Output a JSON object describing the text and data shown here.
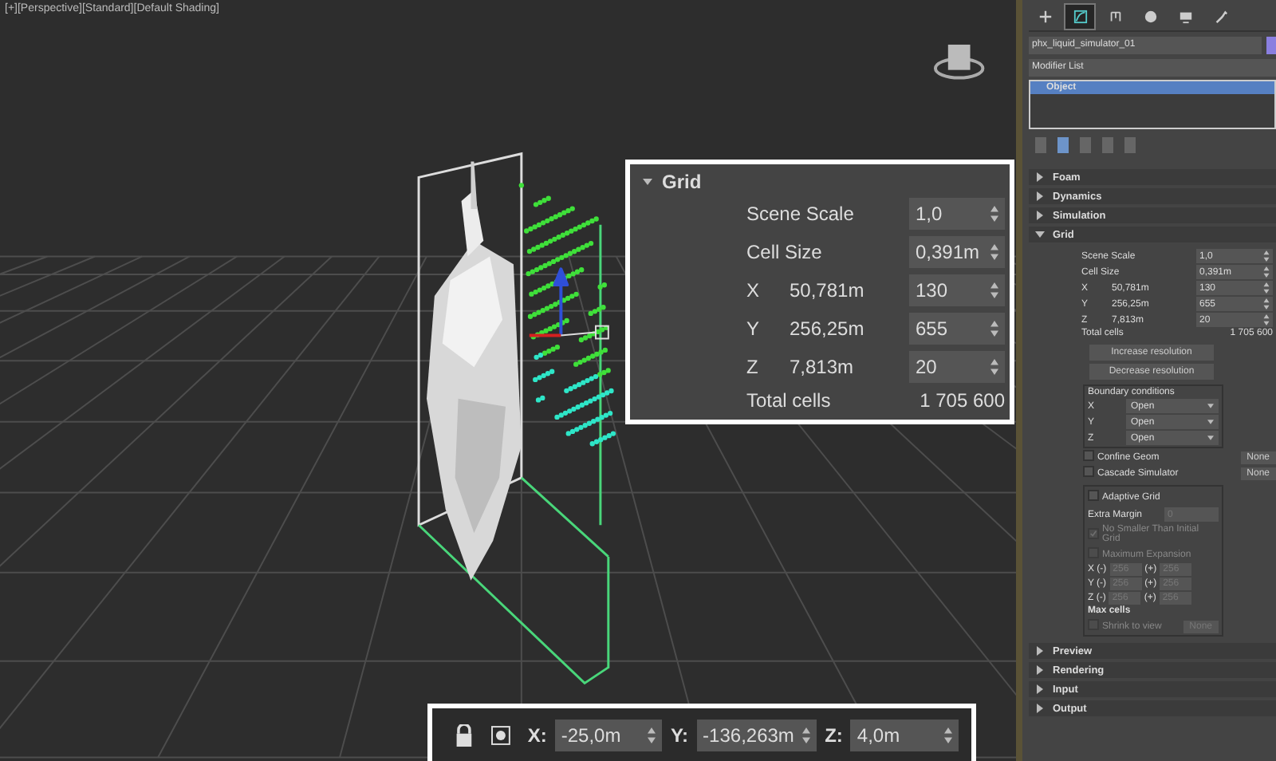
{
  "viewport": {
    "labels": [
      "[+]",
      "[Perspective]",
      "[Standard]",
      "[Default Shading]"
    ]
  },
  "grid_callout": {
    "title": "Grid",
    "expanded": true,
    "rows": [
      {
        "kind": "param",
        "label": "Scene Scale",
        "value": "1,0"
      },
      {
        "kind": "param",
        "label": "Cell Size",
        "value": "0,391m"
      },
      {
        "kind": "axis",
        "label": "X",
        "size": "50,781m",
        "value": "130"
      },
      {
        "kind": "axis",
        "label": "Y",
        "size": "256,25m",
        "value": "655"
      },
      {
        "kind": "axis",
        "label": "Z",
        "size": "7,813m",
        "value": "20"
      },
      {
        "kind": "total",
        "label": "Total cells",
        "value": "1 705 600"
      }
    ]
  },
  "coordinate_bar": {
    "fields": [
      {
        "label": "X:",
        "value": "-25,0m"
      },
      {
        "label": "Y:",
        "value": "-136,263m"
      },
      {
        "label": "Z:",
        "value": "4,0m"
      }
    ]
  },
  "command_panel": {
    "tabs": [
      {
        "selected": false
      },
      {
        "selected": true
      },
      {
        "selected": false
      },
      {
        "selected": false
      },
      {
        "selected": false
      },
      {
        "selected": false
      }
    ],
    "object_name": "phx_liquid_simulator_01",
    "modifier_list": "Modifier List",
    "stack": [
      {
        "label": "Object",
        "selected": true
      }
    ],
    "stack_tools": [
      {
        "selected": false
      },
      {
        "selected": true
      },
      {
        "selected": false
      },
      {
        "selected": false
      },
      {
        "selected": false
      }
    ],
    "rollouts_before": [
      {
        "title": "Foam",
        "expanded": false
      },
      {
        "title": "Dynamics",
        "expanded": false
      },
      {
        "title": "Simulation",
        "expanded": false
      }
    ],
    "grid_rollout": {
      "title": "Grid",
      "expanded": true,
      "rows": [
        {
          "kind": "param",
          "label": "Scene Scale",
          "value": "1,0"
        },
        {
          "kind": "param",
          "label": "Cell Size",
          "value": "0,391m"
        },
        {
          "kind": "axis",
          "label": "X",
          "size": "50,781m",
          "value": "130"
        },
        {
          "kind": "axis",
          "label": "Y",
          "size": "256,25m",
          "value": "655"
        },
        {
          "kind": "axis",
          "label": "Z",
          "size": "7,813m",
          "value": "20"
        },
        {
          "kind": "total",
          "label": "Total cells",
          "value": "1 705 600"
        }
      ],
      "buttons": [
        "Increase resolution",
        "Decrease resolution"
      ],
      "boundary": {
        "title": "Boundary conditions",
        "axes": [
          {
            "label": "X",
            "value": "Open"
          },
          {
            "label": "Y",
            "value": "Open"
          },
          {
            "label": "Z",
            "value": "Open"
          }
        ]
      },
      "options": [
        {
          "label": "Confine Geom",
          "checked": false,
          "button": "None"
        },
        {
          "label": "Cascade Simulator",
          "checked": false,
          "button": "None"
        }
      ],
      "adaptive": {
        "label": "Adaptive Grid",
        "checked": false,
        "disabled": true,
        "extra_margin": {
          "label": "Extra Margin",
          "value": "0"
        },
        "checks": [
          {
            "label": "No Smaller Than Initial Grid",
            "checked": true
          },
          {
            "label": "Maximum Expansion",
            "checked": false
          }
        ],
        "expansion": [
          {
            "label": "X (-)",
            "minus": "256",
            "plus_label": "(+)",
            "plus": "256"
          },
          {
            "label": "Y (-)",
            "minus": "256",
            "plus_label": "(+)",
            "plus": "256"
          },
          {
            "label": "Z (-)",
            "minus": "256",
            "plus_label": "(+)",
            "plus": "256"
          }
        ],
        "max_cells": "Max cells",
        "shrink": {
          "label": "Shrink to view",
          "checked": false,
          "button": "None"
        }
      }
    },
    "rollouts_after": [
      {
        "title": "Preview",
        "expanded": false
      },
      {
        "title": "Rendering",
        "expanded": false
      },
      {
        "title": "Input",
        "expanded": false
      },
      {
        "title": "Output",
        "expanded": false
      }
    ]
  }
}
